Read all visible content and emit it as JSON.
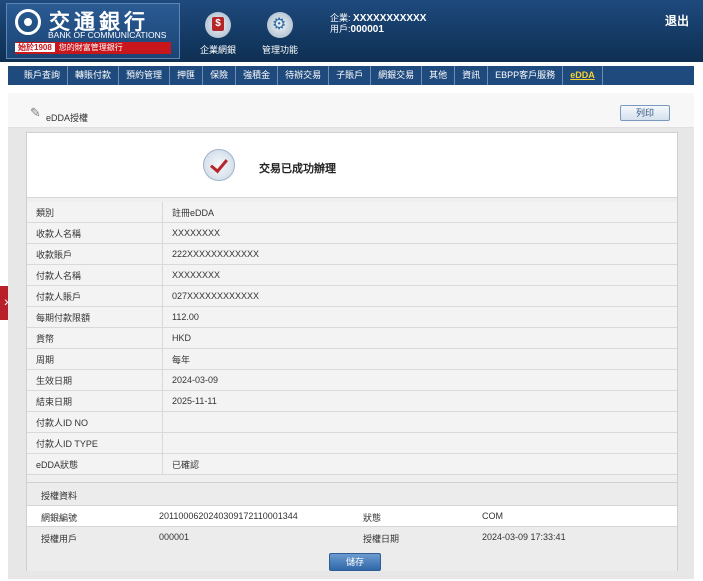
{
  "brand": {
    "name_cn": "交通銀行",
    "name_en": "BANK OF COMMUNICATIONS",
    "slogan_year": "始於1908",
    "slogan_text": "您的財富管理銀行"
  },
  "top_buttons": [
    {
      "label": "企業網銀",
      "icon": "corporate-banking-icon"
    },
    {
      "label": "管理功能",
      "icon": "gear-icon"
    }
  ],
  "enterprise": {
    "company_label": "企業:",
    "company_value": "XXXXXXXXXXX",
    "user_label": "用戶:",
    "user_value": "000001"
  },
  "logout_label": "退出",
  "nav": {
    "items": [
      "賬戶查詢",
      "轉賬付款",
      "預約管理",
      "押匯",
      "保險",
      "強積金",
      "待辦交易",
      "子賬戶",
      "網銀交易",
      "其他",
      "資訊",
      "EBPP客戶服務",
      "eDDA"
    ],
    "active": "eDDA"
  },
  "page": {
    "title": "eDDA授權",
    "print_label": "列印",
    "success_message": "交易已成功辦理"
  },
  "details": [
    {
      "label": "類別",
      "value": "註冊eDDA"
    },
    {
      "label": "收款人名稱",
      "value": "XXXXXXXX"
    },
    {
      "label": "收款賬戶",
      "value": "222XXXXXXXXXXXX"
    },
    {
      "label": "付款人名稱",
      "value": "XXXXXXXX"
    },
    {
      "label": "付款人賬戶",
      "value": "027XXXXXXXXXXXX"
    },
    {
      "label": "每期付款限額",
      "value": "112.00"
    },
    {
      "label": "貨幣",
      "value": "HKD"
    },
    {
      "label": "周期",
      "value": "每年"
    },
    {
      "label": "生效日期",
      "value": "2024-03-09"
    },
    {
      "label": "結束日期",
      "value": "2025-11-11"
    },
    {
      "label": "付款人ID NO",
      "value": ""
    },
    {
      "label": "付款人ID TYPE",
      "value": ""
    },
    {
      "label": "eDDA狀態",
      "value": "已確認"
    }
  ],
  "authorization": {
    "title": "授權資料",
    "ref_label": "網銀編號",
    "ref_value": "2011000620240309172110001344",
    "status_label": "狀態",
    "status_value": "COM",
    "user_label": "授權用戶",
    "user_value": "000001",
    "date_label": "授權日期",
    "date_value": "2024-03-09 17:33:41"
  },
  "save_label": "儲存"
}
